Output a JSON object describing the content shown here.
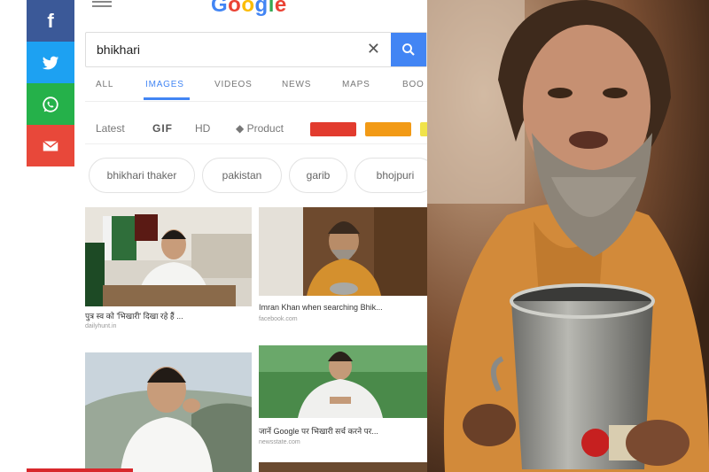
{
  "share": {
    "facebook": "f",
    "twitter": "twitter-icon",
    "whatsapp": "whatsapp-icon",
    "email": "email-icon"
  },
  "google": {
    "logo": "Google",
    "query": "bhikhari",
    "clear": "✕",
    "tabs": [
      "ALL",
      "IMAGES",
      "VIDEOS",
      "NEWS",
      "MAPS",
      "BOO"
    ],
    "active_tab": "IMAGES",
    "filters": [
      "Latest",
      "GIF",
      "HD",
      "Product"
    ],
    "color_filters": [
      "#e23b2e",
      "#f29a16",
      "#f0e34a"
    ],
    "chips": [
      "bhikhari thaker",
      "pakistan",
      "garib",
      "bhojpuri"
    ],
    "results": [
      {
        "caption": "पुत्र स्व को 'भिखारी' दिखा रहे हैं ...",
        "source": "dailyhunt.in"
      },
      {
        "caption": "Imran Khan when searching Bhik...",
        "source": "facebook.com"
      },
      {
        "caption": "",
        "source": ""
      },
      {
        "caption": "जानें Google पर भिखारी सर्च करने पर...",
        "source": "newsstate.com"
      }
    ]
  },
  "colors": {
    "google_blue": "#4285f4",
    "facebook": "#3b5998",
    "twitter": "#1da1f2",
    "whatsapp": "#25b14a",
    "email": "#e8483a"
  }
}
